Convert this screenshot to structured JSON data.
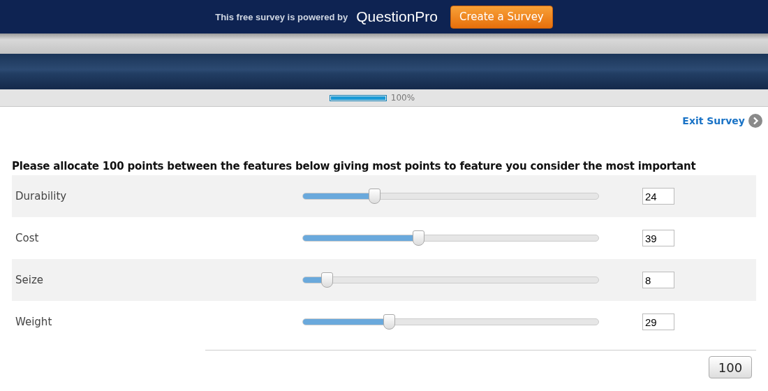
{
  "promo_bar": {
    "text": "This free survey is powered by",
    "brand": "QuestionPro",
    "button": "Create a Survey"
  },
  "progress": {
    "level": 1,
    "reading": "100%"
  },
  "exit_link": "Exit Survey",
  "question": "Please allocate 100 points between the features below giving most points to feature you consider the most important",
  "features": [
    {
      "label": "Durability",
      "level": 0.24,
      "value": "24"
    },
    {
      "label": "Cost",
      "level": 0.39,
      "value": "39"
    },
    {
      "label": "Seize",
      "level": 0.08,
      "value": "8"
    },
    {
      "label": "Weight",
      "level": 0.29,
      "value": "29"
    }
  ],
  "total": "100"
}
